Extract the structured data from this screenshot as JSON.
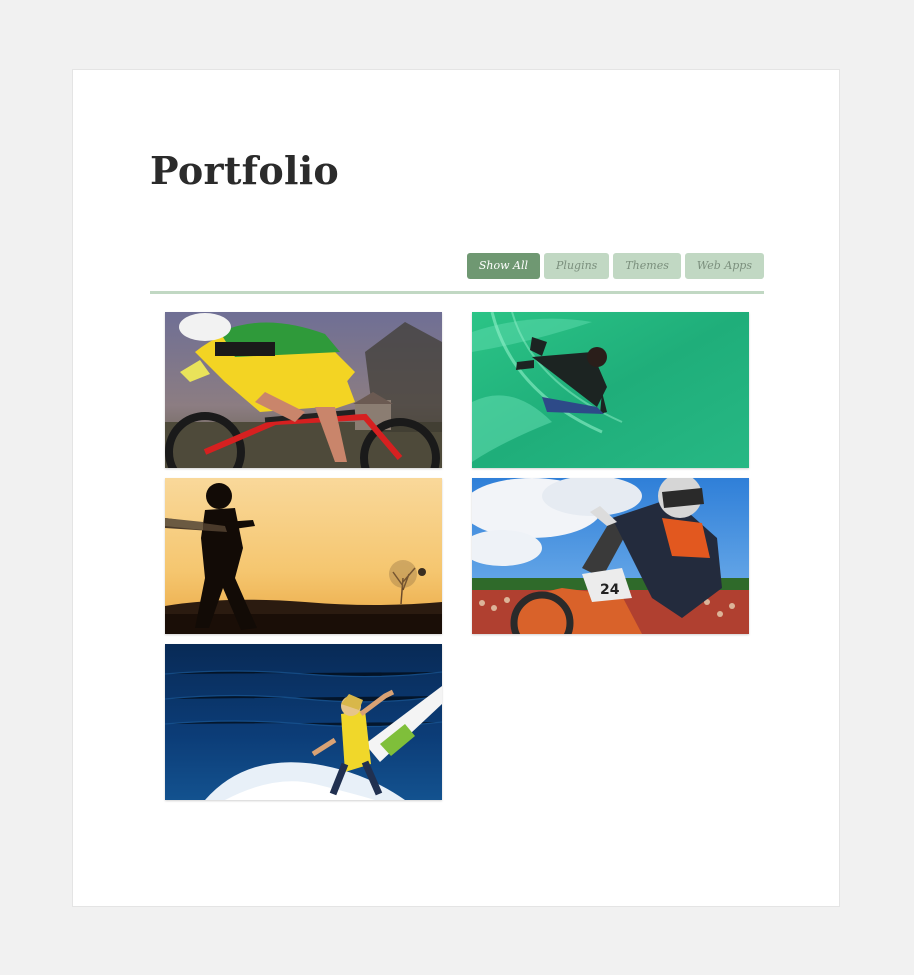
{
  "page": {
    "title": "Portfolio"
  },
  "filters": [
    {
      "label": "Show All",
      "active": true
    },
    {
      "label": "Plugins",
      "active": false
    },
    {
      "label": "Themes",
      "active": false
    },
    {
      "label": "Web Apps",
      "active": false
    }
  ],
  "colors": {
    "accent": "#6f9872",
    "accent_light": "#c1d8c3",
    "background": "#f1f1f1",
    "card": "#ffffff"
  },
  "portfolio_items": [
    {
      "subject": "cyclist"
    },
    {
      "subject": "bodyboarder"
    },
    {
      "subject": "cricket batsman silhouette"
    },
    {
      "subject": "motocross rider"
    },
    {
      "subject": "surfer"
    }
  ]
}
